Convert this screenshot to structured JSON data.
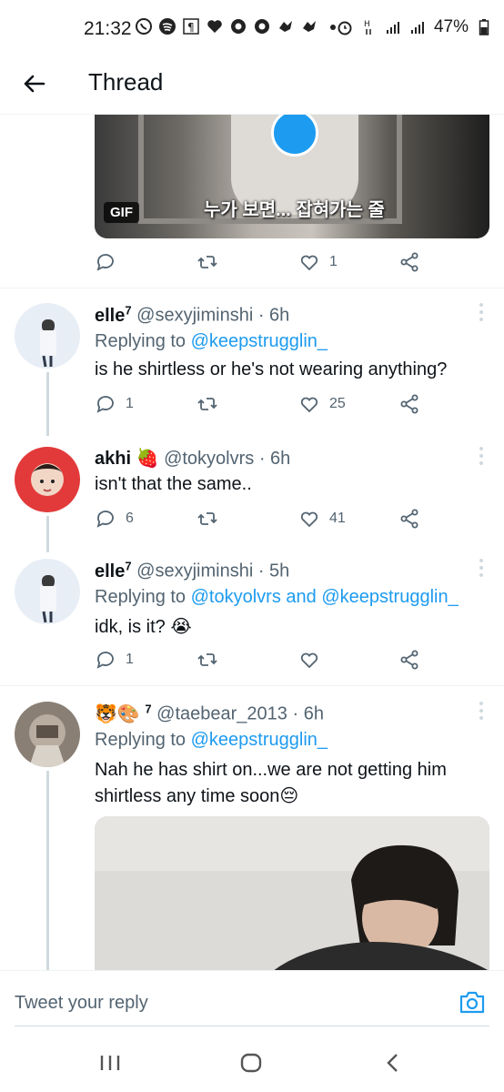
{
  "status_bar": {
    "time": "21:32",
    "battery": "47%",
    "icons_left": [
      "whatsapp-icon",
      "spotify-icon",
      "paragraph-icon",
      "heart-icon",
      "chrome-icon",
      "chrome-icon",
      "bird-icon",
      "bird-icon",
      "dot-icon"
    ],
    "icons_right": [
      "alarm-icon",
      "data-icon",
      "signal-icon",
      "signal-icon",
      "battery-icon"
    ]
  },
  "header": {
    "title": "Thread"
  },
  "gif": {
    "badge": "GIF",
    "subtitle": "누가 보면... 잡혀가는 줄"
  },
  "top_actions": {
    "reply_count": "",
    "retweet_count": "",
    "like_count": "1"
  },
  "tweets": [
    {
      "name": "elle",
      "name_sup": "7",
      "handle": "@sexyjiminshi · 6h",
      "replying_prefix": "Replying to ",
      "replying_to": "@keepstrugglin_",
      "text": "is he shirtless or he's not wearing anything?",
      "reply_count": "1",
      "retweet_count": "",
      "like_count": "25"
    },
    {
      "name": "akhi",
      "name_emoji": "🍓",
      "handle": "@tokyolvrs · 6h",
      "text": "isn't that the same..",
      "reply_count": "6",
      "retweet_count": "",
      "like_count": "41"
    },
    {
      "name": "elle",
      "name_sup": "7",
      "handle": "@sexyjiminshi · 5h",
      "replying_prefix": "Replying to ",
      "replying_to": "@tokyolvrs and @keepstrugglin_",
      "text": "idk, is it? 😭",
      "reply_count": "1",
      "retweet_count": "",
      "like_count": ""
    },
    {
      "name": "🐯🎨",
      "name_sup": "7",
      "handle": "@taebear_2013 · 6h",
      "replying_prefix": "Replying to ",
      "replying_to": "@keepstrugglin_",
      "text": "Nah he has shirt on...we are not getting him shirtless any time soon😔"
    }
  ],
  "composer": {
    "placeholder": "Tweet your reply"
  },
  "colors": {
    "accent": "#1d9bf0",
    "secondary_text": "#536471",
    "divider": "#eff3f4"
  }
}
